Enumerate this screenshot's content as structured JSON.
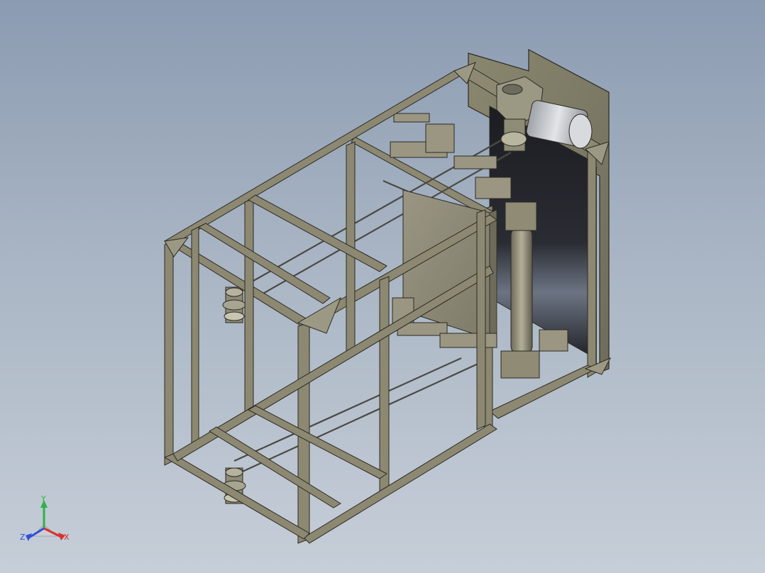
{
  "viewport": {
    "background_top": "#8b9bb1",
    "background_bottom": "#c6ced8"
  },
  "model": {
    "frame_color": "#8c8872",
    "frame_edge": "#2b2a22",
    "panel_color": "#7f7c6a",
    "motor_color": "#c9ccd0"
  },
  "triad": {
    "x_label": "X",
    "y_label": "Y",
    "z_label": "Z",
    "x_color": "#d8302e",
    "y_color": "#2fb24a",
    "z_color": "#2f4fd8"
  }
}
